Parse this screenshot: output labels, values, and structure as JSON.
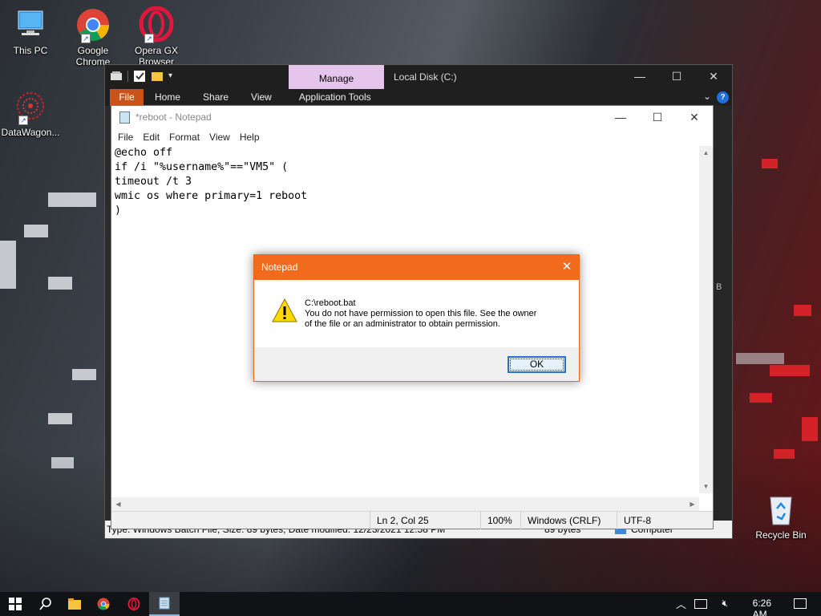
{
  "desktop": {
    "icons": [
      {
        "label": "This PC",
        "icon": "this-pc-icon"
      },
      {
        "label": "Google Chrome",
        "icon": "chrome-icon"
      },
      {
        "label": "Opera GX Browser",
        "icon": "opera-gx-icon"
      },
      {
        "label": "DataWagon...",
        "icon": "datawagon-icon"
      },
      {
        "label": "Recycle Bin",
        "icon": "recycle-bin-icon"
      }
    ]
  },
  "explorer": {
    "manage_tab": "Manage",
    "title": "Local Disk (C:)",
    "ribbon_tabs": [
      "File",
      "Home",
      "Share",
      "View",
      "Application Tools"
    ],
    "status_text": "Type: Windows Batch File, Size: 89 bytes, Date modified: 12/23/2021 12:58 PM",
    "status_size": "89 bytes",
    "status_location": "Computer",
    "side_fragment": "B"
  },
  "notepad": {
    "title": "*reboot - Notepad",
    "menu": [
      "File",
      "Edit",
      "Format",
      "View",
      "Help"
    ],
    "content": "@echo off\nif /i \"%username%\"==\"VM5\" (\ntimeout /t 3\nwmic os where primary=1 reboot\n)",
    "status": {
      "position": "Ln 2, Col 25",
      "zoom": "100%",
      "line_ending": "Windows (CRLF)",
      "encoding": "UTF-8"
    }
  },
  "dialog": {
    "title": "Notepad",
    "path": "C:\\reboot.bat",
    "message_line1": "You do not have permission to open this file.  See the owner",
    "message_line2": "of the file or an administrator to obtain permission.",
    "ok_label": "OK"
  },
  "taskbar": {
    "time": "6:26 AM"
  },
  "colors": {
    "dialog_title": "#f26b1d",
    "manage_tab": "#e6c5ec",
    "file_tab": "#c8531b"
  }
}
